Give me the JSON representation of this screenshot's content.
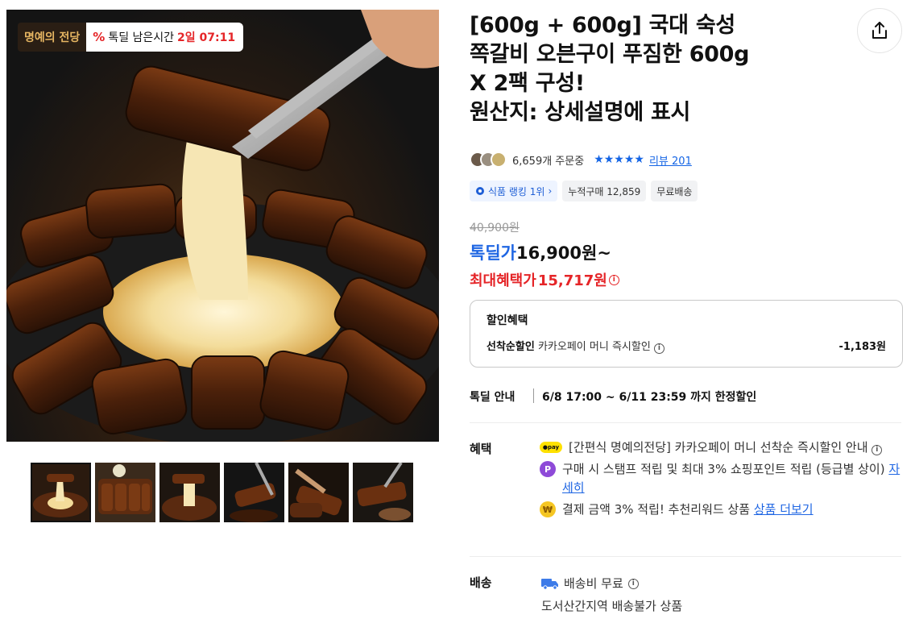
{
  "badge": {
    "brand": "명예의 전당",
    "timer_label": "톡딜 남은시간",
    "timer_value": "2일 07:11",
    "pct_symbol": "%"
  },
  "product": {
    "title_lines": [
      "[600g + 600g] 국대 숙성",
      "쪽갈비 오븐구이 푸짐한 600g",
      "X 2팩 구성!",
      "원산지: 상세설명에 표시"
    ],
    "order_count": "6,659개 주문중",
    "stars": "★★★★★",
    "review_link": "리뷰 201"
  },
  "chips": {
    "rank": "식품 랭킹 1위",
    "rank_arrow": "›",
    "cumulative": "누적구매 12,859",
    "shipping": "무료배송"
  },
  "price": {
    "original": "40,900원",
    "deal_label": "톡딜가",
    "deal_price": "16,900원~",
    "max_label": "최대혜택가",
    "max_price": "15,717원"
  },
  "discount": {
    "header": "할인혜택",
    "row_bold": "선착순할인",
    "row_text": "카카오페이 머니 즉시할인",
    "amount": "-1,183원"
  },
  "deal_info": {
    "label": "톡딜 안내",
    "value": "6/8 17:00 ~ 6/11 23:59 까지 한정할인"
  },
  "benefits": {
    "label": "혜택",
    "items": [
      {
        "text": "[간편식 명예의전당] 카카오페이 머니 선착순 즉시할인 안내",
        "icon": "pay-icon"
      },
      {
        "text": "구매 시 스탬프 적립 및 최대 3% 쇼핑포인트 적립 (등급별 상이)",
        "link": "자세히",
        "icon": "point-icon"
      },
      {
        "text": "결제 금액 3% 적립! 추천리워드 상품",
        "link": "상품 더보기",
        "icon": "won-icon"
      }
    ],
    "pay_icon_text": "●pay",
    "p_icon_text": "P",
    "w_icon_text": "₩"
  },
  "shipping": {
    "label": "배송",
    "fee": "배송비 무료",
    "note": "도서산간지역 배송불가 상품"
  },
  "colors": {
    "accent_blue": "#1f66e3",
    "accent_red": "#e52528",
    "star_blue": "#1565e5"
  }
}
